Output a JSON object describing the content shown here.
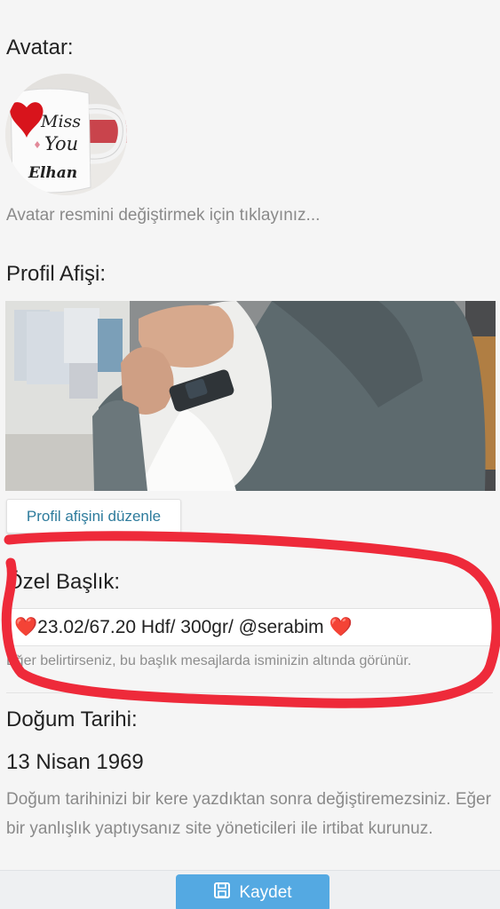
{
  "avatar": {
    "label": "Avatar:",
    "mug_text_1": "Miss",
    "mug_text_2": "You",
    "mug_text_3": "Elhan",
    "hint": "Avatar resmini değiştirmek için tıklayınız..."
  },
  "banner": {
    "label": "Profil Afişi:",
    "edit_button": "Profil afişini düzenle"
  },
  "custom_title": {
    "label": "Özel Başlık:",
    "value": "❤️23.02/67.20 Hdf/ 300gr/ @serabim ❤️",
    "hint": "Eğer belirtirseniz, bu başlık mesajlarda isminizin altında görünür."
  },
  "birthday": {
    "label": "Doğum Tarihi:",
    "value": "13 Nisan 1969",
    "hint": "Doğum tarihinizi bir kere yazdıktan sonra değiştiremezsiniz. Eğer bir yanlışlık yaptıysanız site yöneticileri ile irtibat kurunuz."
  },
  "footer": {
    "save_button": "Kaydet",
    "save_icon": "floppy-disk-icon"
  },
  "colors": {
    "accent": "#54a9e2",
    "link": "#2d7b9c",
    "annotation": "#ee2a3a"
  }
}
